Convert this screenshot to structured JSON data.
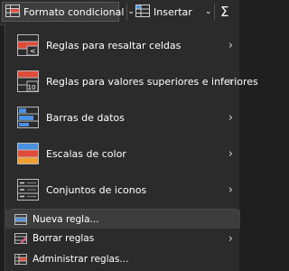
{
  "toolbar": {
    "formato_label": "Formato condicional",
    "insertar_label": "Insertar",
    "sigma_symbol": "Σ"
  },
  "menu": {
    "items": [
      {
        "label": "Reglas para resaltar celdas",
        "icon": "highlight-cells-rules-icon"
      },
      {
        "label": "Reglas para valores superiores e inferiores",
        "icon": "top-bottom-rules-icon"
      },
      {
        "label": "Barras de datos",
        "icon": "data-bars-icon"
      },
      {
        "label": "Escalas de color",
        "icon": "color-scales-icon"
      },
      {
        "label": "Conjuntos de iconos",
        "icon": "icon-sets-icon"
      }
    ],
    "actions": [
      {
        "label": "Nueva regla...",
        "icon": "new-rule-icon"
      },
      {
        "label": "Borrar reglas",
        "icon": "clear-rules-icon"
      },
      {
        "label": "Administrar reglas...",
        "icon": "manage-rules-icon"
      }
    ]
  },
  "colors": {
    "accent_blue": "#4a90e2",
    "accent_red": "#e04b3a",
    "accent_orange": "#f0a030",
    "background": "#2b2b2b"
  }
}
